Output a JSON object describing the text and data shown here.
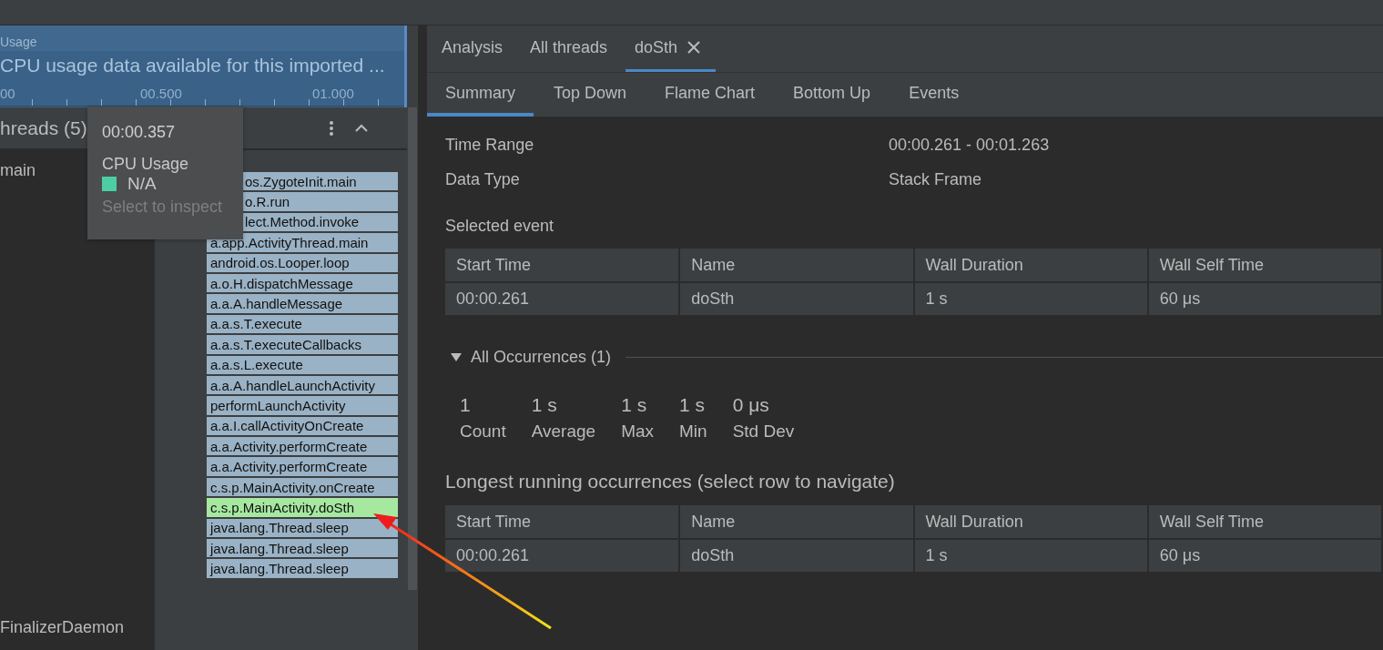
{
  "cpu_usage": {
    "title": "Usage",
    "message": "CPU usage data available for this imported ...",
    "ticks": [
      "00",
      "00.500",
      "01.000"
    ]
  },
  "threads": {
    "title": "hreads (5)",
    "items": [
      {
        "name": "main",
        "selected": false
      },
      {
        "name": "FinalizerDaemon",
        "selected": false
      }
    ]
  },
  "flame_frames": [
    {
      "label": "os.ZygoteInit.main",
      "selected": false,
      "clipped": true
    },
    {
      "label": "o.R.run",
      "selected": false,
      "clipped": true
    },
    {
      "label": "lect.Method.invoke",
      "selected": false,
      "clipped": true
    },
    {
      "label": "a.app.ActivityThread.main",
      "selected": false,
      "clipped": false
    },
    {
      "label": "android.os.Looper.loop",
      "selected": false,
      "clipped": false
    },
    {
      "label": "a.o.H.dispatchMessage",
      "selected": false,
      "clipped": false
    },
    {
      "label": "a.a.A.handleMessage",
      "selected": false,
      "clipped": false
    },
    {
      "label": "a.a.s.T.execute",
      "selected": false,
      "clipped": false
    },
    {
      "label": "a.a.s.T.executeCallbacks",
      "selected": false,
      "clipped": false
    },
    {
      "label": "a.a.s.L.execute",
      "selected": false,
      "clipped": false
    },
    {
      "label": "a.a.A.handleLaunchActivity",
      "selected": false,
      "clipped": false
    },
    {
      "label": "performLaunchActivity",
      "selected": false,
      "clipped": false
    },
    {
      "label": "a.a.I.callActivityOnCreate",
      "selected": false,
      "clipped": false
    },
    {
      "label": "a.a.Activity.performCreate",
      "selected": false,
      "clipped": false
    },
    {
      "label": "a.a.Activity.performCreate",
      "selected": false,
      "clipped": false
    },
    {
      "label": "c.s.p.MainActivity.onCreate",
      "selected": false,
      "clipped": false
    },
    {
      "label": "c.s.p.MainActivity.doSth",
      "selected": true,
      "clipped": false
    },
    {
      "label": "java.lang.Thread.sleep",
      "selected": false,
      "clipped": false
    },
    {
      "label": "java.lang.Thread.sleep",
      "selected": false,
      "clipped": false
    },
    {
      "label": "java.lang.Thread.sleep",
      "selected": false,
      "clipped": false
    }
  ],
  "tooltip": {
    "time": "00:00.357",
    "series": "CPU Usage",
    "value": "N/A",
    "color": "#4ecca3",
    "hint": "Select to inspect"
  },
  "tabs": [
    {
      "label": "Analysis",
      "selected": false,
      "closable": false
    },
    {
      "label": "All threads",
      "selected": false,
      "closable": false
    },
    {
      "label": "doSth",
      "selected": true,
      "closable": true
    }
  ],
  "subtabs": [
    {
      "label": "Summary",
      "selected": true
    },
    {
      "label": "Top Down",
      "selected": false
    },
    {
      "label": "Flame Chart",
      "selected": false
    },
    {
      "label": "Bottom Up",
      "selected": false
    },
    {
      "label": "Events",
      "selected": false
    }
  ],
  "summary": {
    "fields": [
      {
        "label": "Time Range",
        "value": "00:00.261 - 00:01.263"
      },
      {
        "label": "Data Type",
        "value": "Stack Frame"
      }
    ],
    "selected_event": {
      "title": "Selected event",
      "columns": [
        "Start Time",
        "Name",
        "Wall Duration",
        "Wall Self Time"
      ],
      "rows": [
        [
          "00:00.261",
          "doSth",
          "1 s",
          "60 μs"
        ]
      ]
    },
    "occurrences": {
      "title": "All Occurrences (1)",
      "expanded": true,
      "stats": [
        {
          "value": "1",
          "label": "Count"
        },
        {
          "value": "1 s",
          "label": "Average"
        },
        {
          "value": "1 s",
          "label": "Max"
        },
        {
          "value": "1 s",
          "label": "Min"
        },
        {
          "value": "0 μs",
          "label": "Std Dev"
        }
      ]
    },
    "longest": {
      "title": "Longest running occurrences (select row to navigate)",
      "columns": [
        "Start Time",
        "Name",
        "Wall Duration",
        "Wall Self Time"
      ],
      "rows": [
        [
          "00:00.261",
          "doSth",
          "1 s",
          "60 μs"
        ]
      ]
    }
  }
}
